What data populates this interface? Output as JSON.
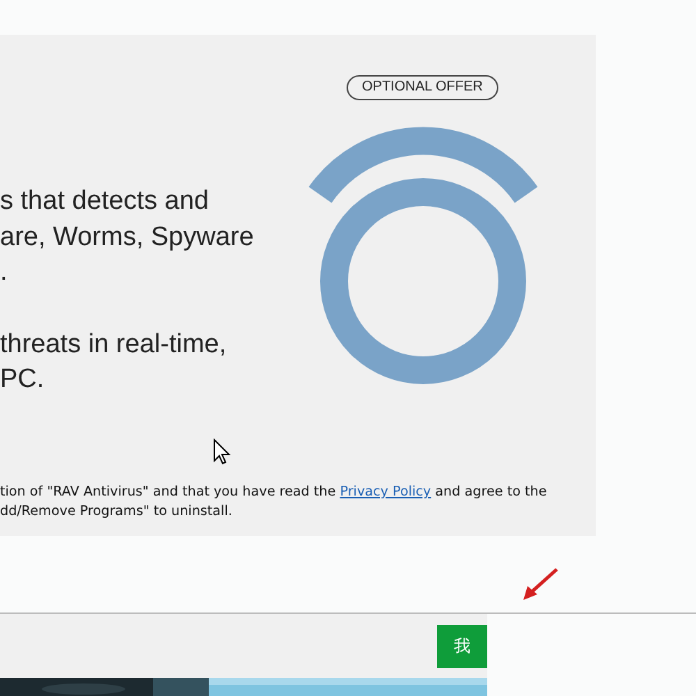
{
  "offer_badge": "OPTIONAL OFFER",
  "description_paragraphs": [
    {
      "lines": [
        "s that detects and",
        "are, Worms, Spyware",
        "."
      ]
    },
    {
      "lines": [
        "threats in real-time,",
        "PC."
      ]
    }
  ],
  "legal": {
    "before": "tion of \"RAV Antivirus\" and that you have read the ",
    "link": "Privacy Policy",
    "after": " and agree to the",
    "line_2": "dd/Remove Programs\" to uninstall."
  },
  "accept_button": "我"
}
